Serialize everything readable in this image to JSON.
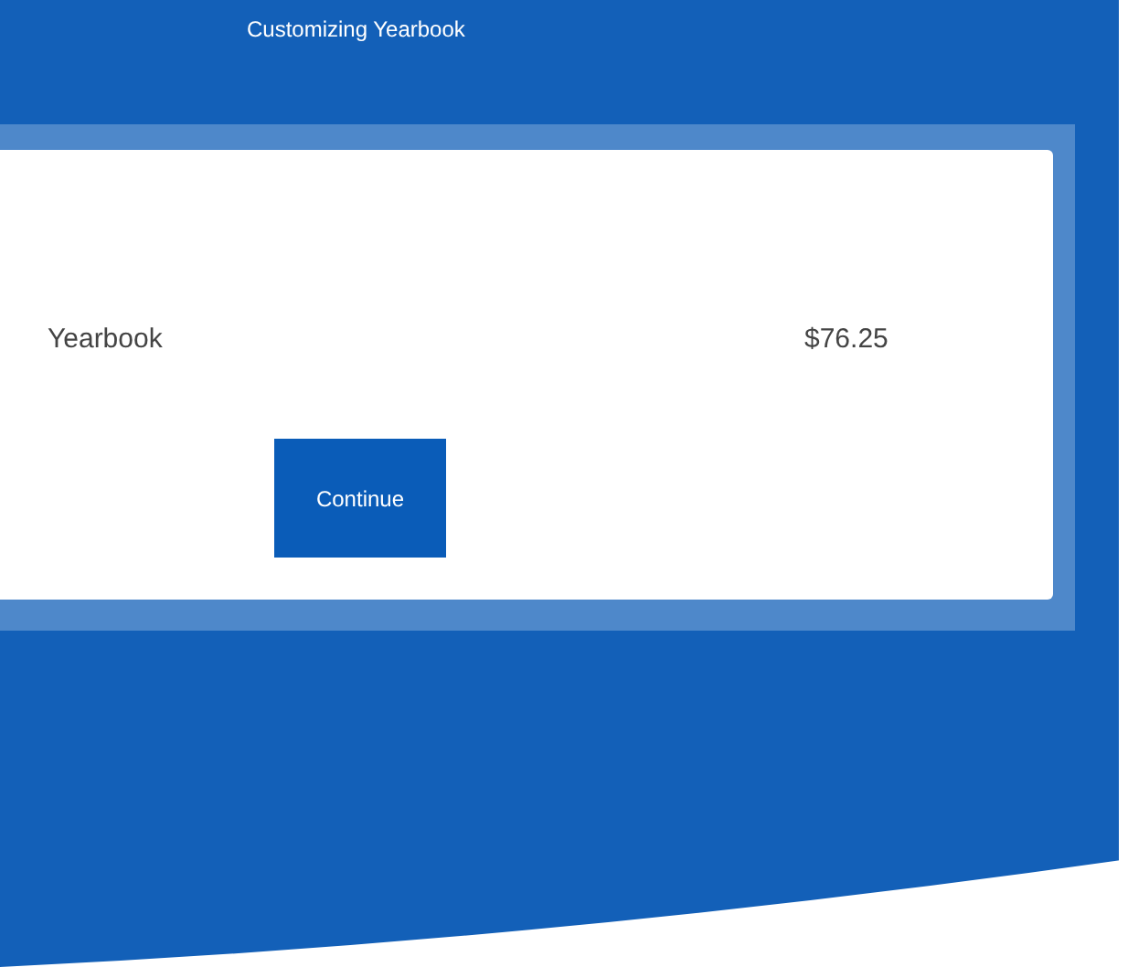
{
  "header": {
    "title": "Customizing Yearbook"
  },
  "items": [
    {
      "name": "Yearbook",
      "price": "$76.25"
    }
  ],
  "buttons": [
    {
      "label": "Continue"
    }
  ]
}
